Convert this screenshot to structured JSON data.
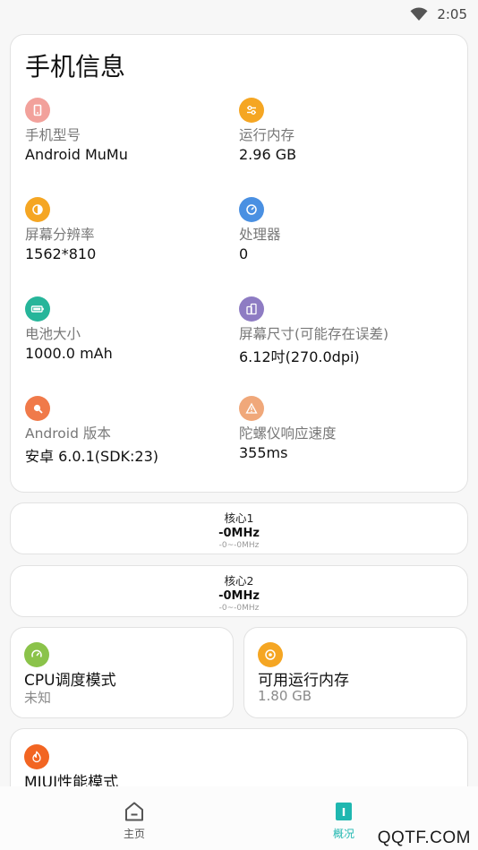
{
  "status": {
    "time": "2:05"
  },
  "info": {
    "title": "手机信息",
    "items": [
      {
        "label": "手机型号",
        "value": "Android MuMu",
        "color": "#f2a19b",
        "icon": "phone-icon"
      },
      {
        "label": "运行内存",
        "value": "2.96 GB",
        "color": "#f5a623",
        "icon": "sliders-icon"
      },
      {
        "label": "屏幕分辨率",
        "value": "1562*810",
        "color": "#f5a623",
        "icon": "contrast-icon"
      },
      {
        "label": "处理器",
        "value": "0",
        "color": "#4a90e2",
        "icon": "gauge-icon"
      },
      {
        "label": "电池大小",
        "value": "1000.0 mAh",
        "color": "#26b59a",
        "icon": "battery-icon"
      },
      {
        "label": "屏幕尺寸(可能存在误差)",
        "value": "6.12吋(270.0dpi)",
        "color": "#8e7cc3",
        "icon": "screens-icon"
      },
      {
        "label": "Android 版本",
        "value": "安卓 6.0.1(SDK:23)",
        "color": "#f07a4a",
        "icon": "android-icon"
      },
      {
        "label": "陀螺仪响应速度",
        "value": "355ms",
        "color": "#f0a87a",
        "icon": "warning-icon"
      }
    ]
  },
  "cores": [
    {
      "name": "核心1",
      "freq": "-0MHz",
      "range": "-0~-0MHz"
    },
    {
      "name": "核心2",
      "freq": "-0MHz",
      "range": "-0~-0MHz"
    }
  ],
  "cpu_mode": {
    "title": "CPU调度模式",
    "value": "未知",
    "color": "#8bc34a"
  },
  "avail_mem": {
    "title": "可用运行内存",
    "value": "1.80 GB",
    "color": "#f5a623"
  },
  "miui": {
    "title": "MIUI性能模式",
    "color": "#f26522"
  },
  "nav": {
    "home": "主页",
    "overview": "概况",
    "active_color": "#1fb7b0"
  },
  "watermark": "QQTF.COM"
}
